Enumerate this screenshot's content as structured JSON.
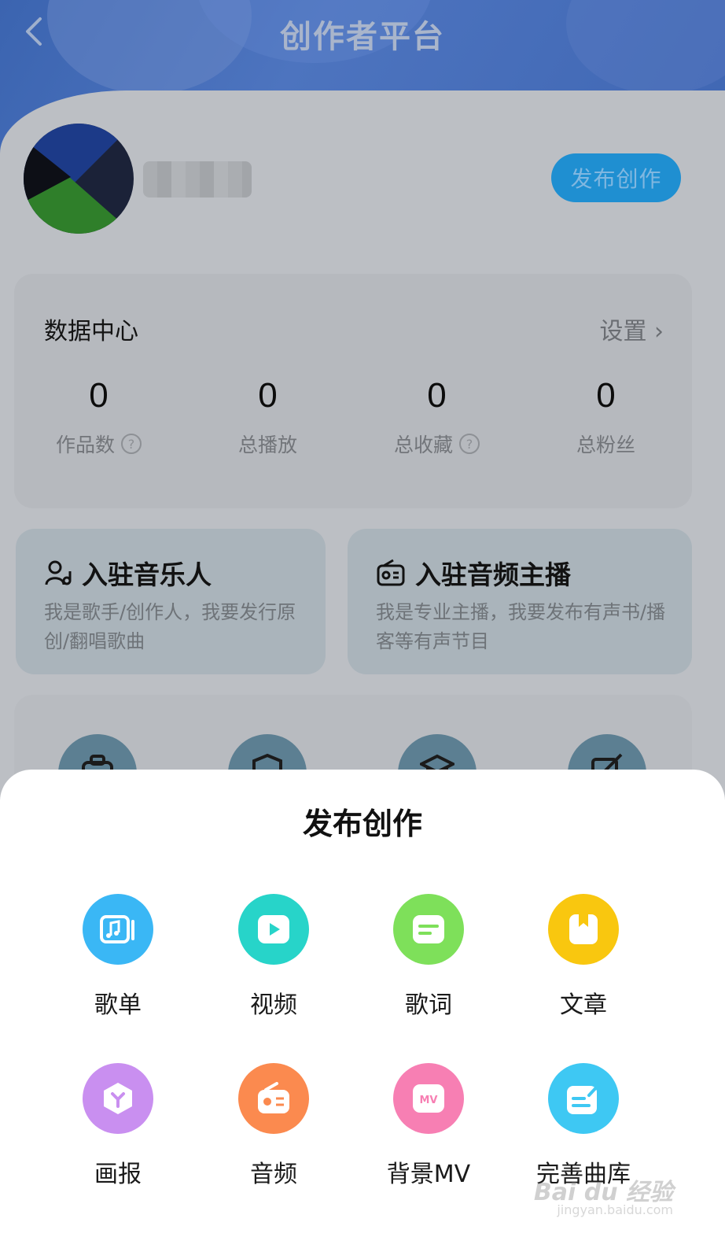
{
  "header": {
    "title": "创作者平台",
    "back_icon": "chevron-left-icon"
  },
  "profile": {
    "publish_label": "发布创作"
  },
  "data_center": {
    "title": "数据中心",
    "settings_label": "设置 ›",
    "stats": [
      {
        "value": "0",
        "label": "作品数",
        "has_help": true
      },
      {
        "value": "0",
        "label": "总播放",
        "has_help": false
      },
      {
        "value": "0",
        "label": "总收藏",
        "has_help": true
      },
      {
        "value": "0",
        "label": "总粉丝",
        "has_help": false
      }
    ],
    "help_glyph": "?"
  },
  "join": [
    {
      "title": "入驻音乐人",
      "desc": "我是歌手/创作人，我要发行原创/翻唱歌曲",
      "icon": "musician-icon"
    },
    {
      "title": "入驻音频主播",
      "desc": "我是专业主播，我要发布有声书/播客等有声节目",
      "icon": "radio-icon"
    }
  ],
  "sheet": {
    "title": "发布创作",
    "options": [
      {
        "label": "歌单",
        "icon": "playlist-icon",
        "color": "#3ab7f5"
      },
      {
        "label": "视频",
        "icon": "video-icon",
        "color": "#27d4c9"
      },
      {
        "label": "歌词",
        "icon": "lyrics-icon",
        "color": "#7ee05a"
      },
      {
        "label": "文章",
        "icon": "article-icon",
        "color": "#f9c70f"
      },
      {
        "label": "画报",
        "icon": "poster-icon",
        "color": "#c98ff0"
      },
      {
        "label": "音频",
        "icon": "audio-icon",
        "color": "#fb8a4f"
      },
      {
        "label": "背景MV",
        "icon": "mv-icon",
        "color": "#f77fb3"
      },
      {
        "label": "完善曲库",
        "icon": "library-edit-icon",
        "color": "#3ec8f3"
      }
    ]
  },
  "watermark": {
    "main": "Bai du 经验",
    "sub": "jingyan.baidu.com"
  }
}
